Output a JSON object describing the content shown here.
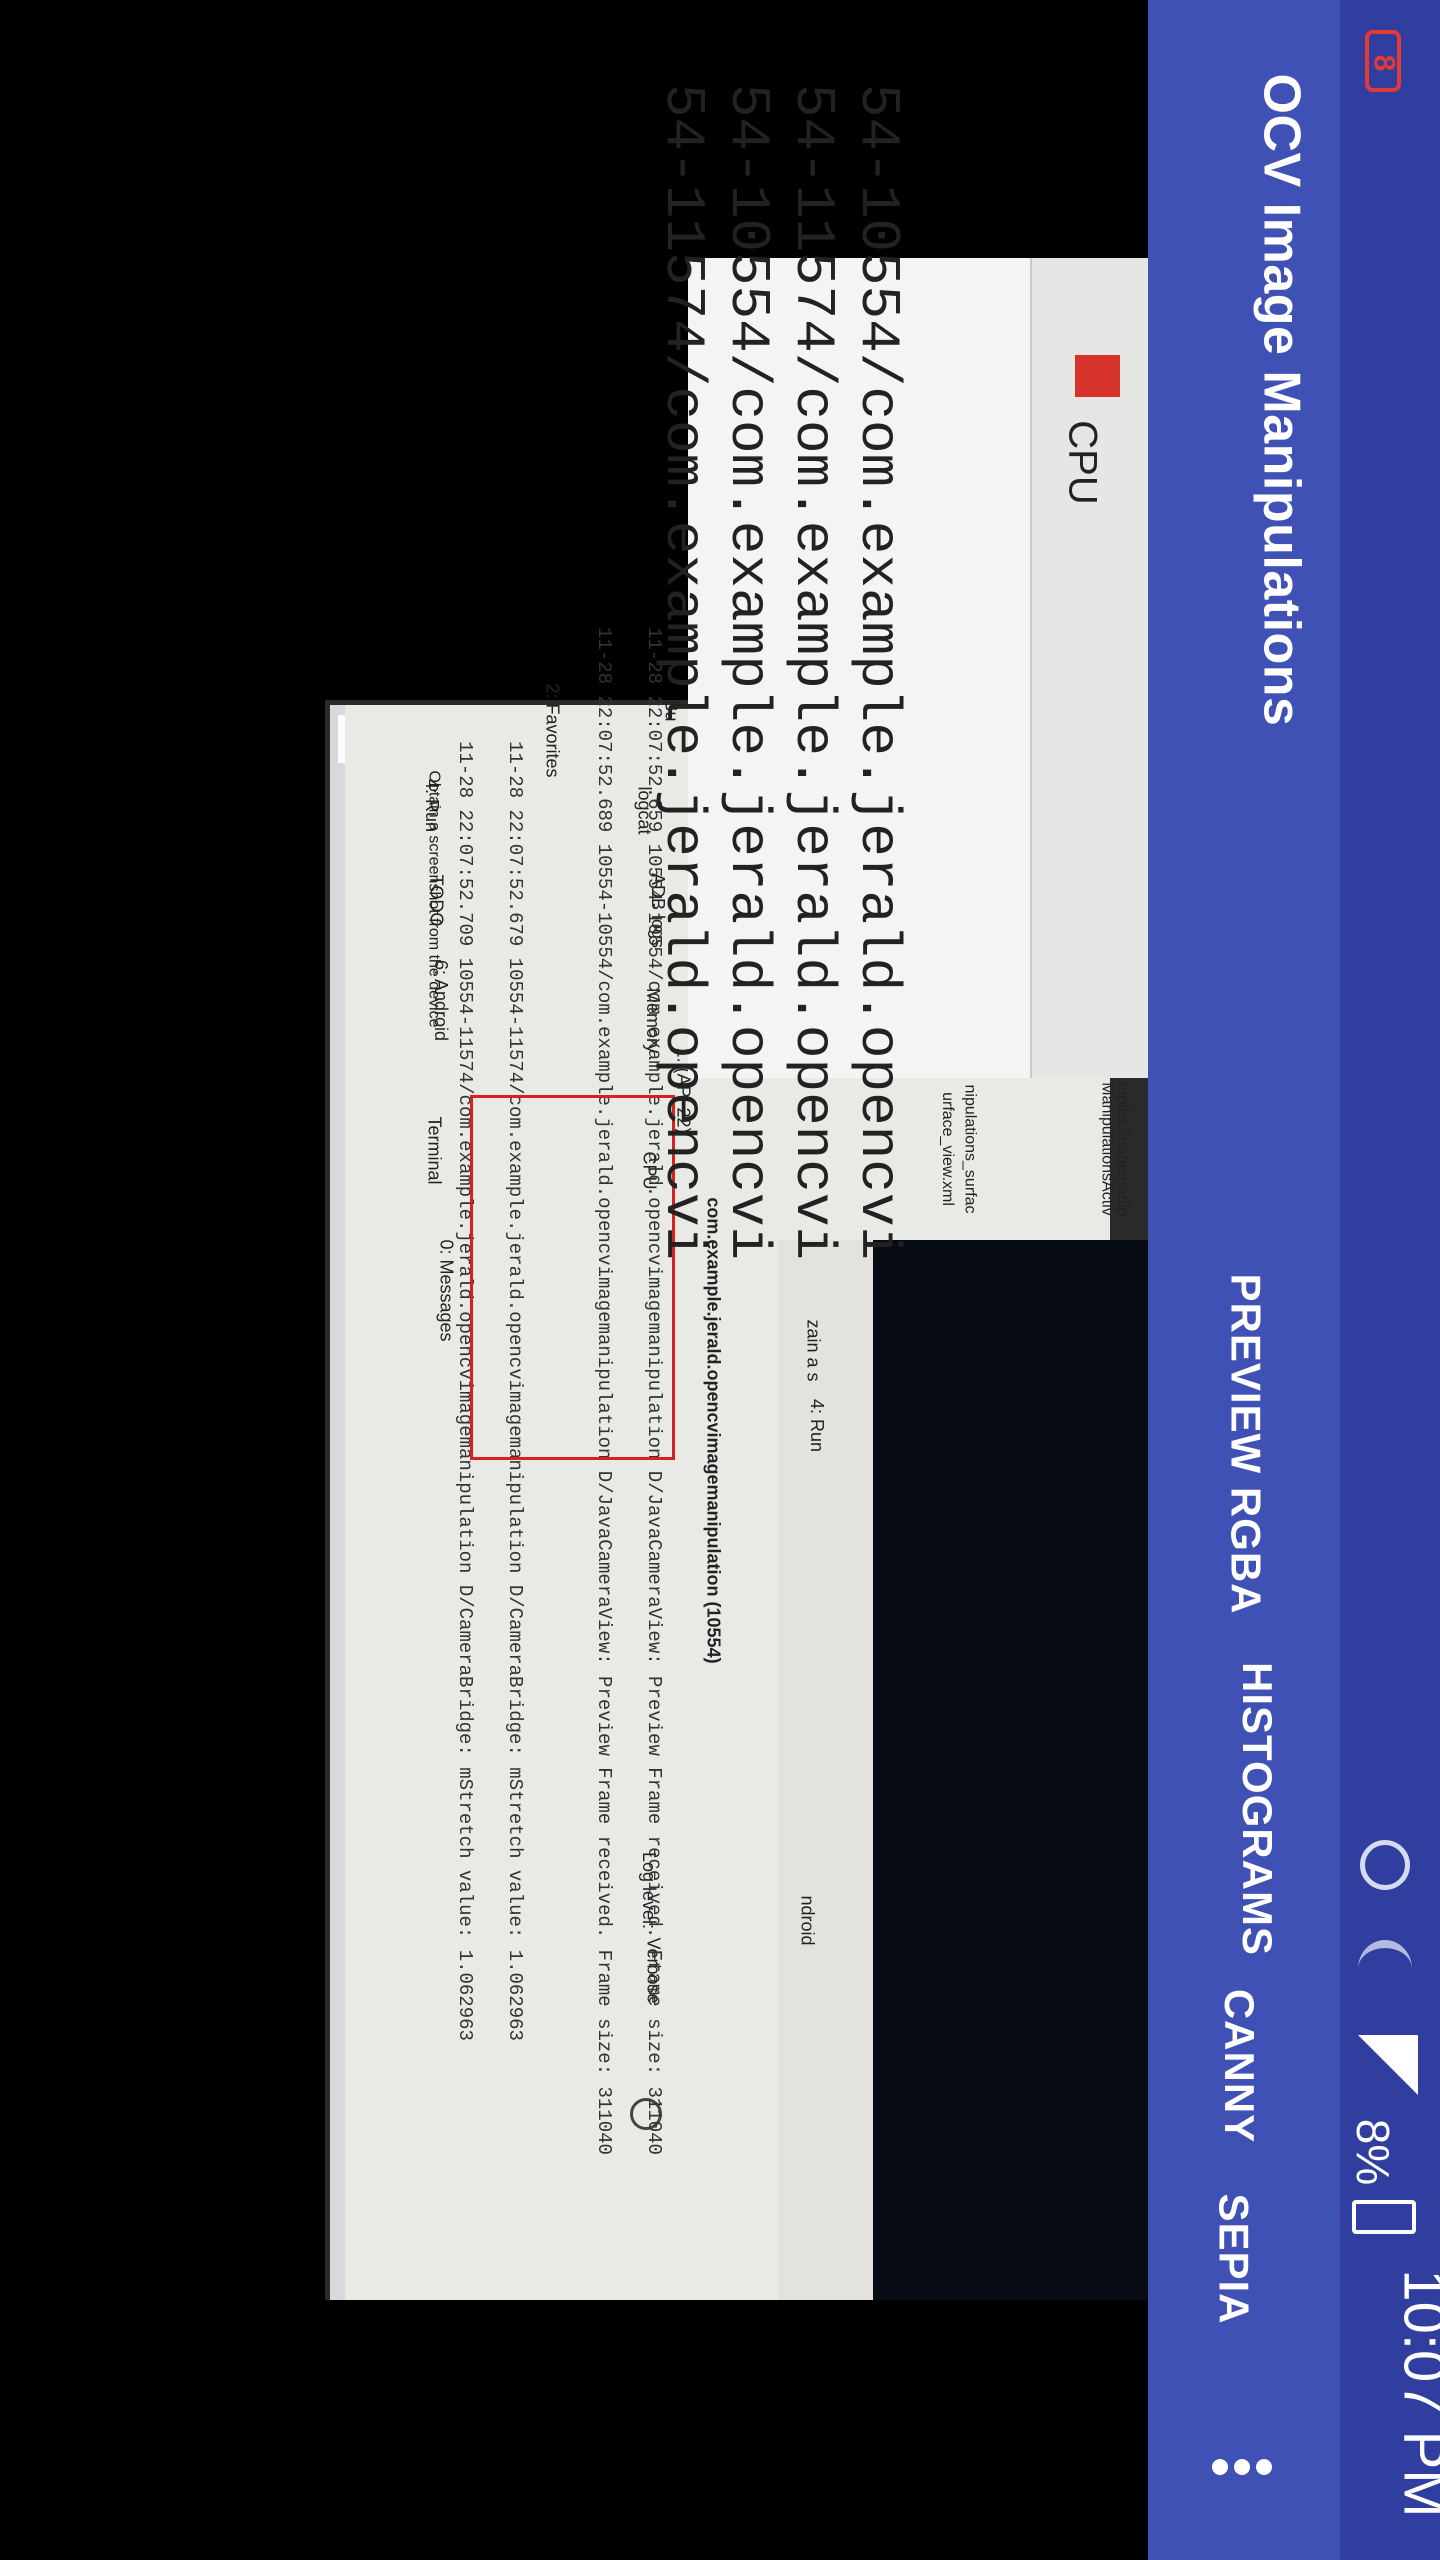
{
  "status_bar": {
    "time": "10:07 PM",
    "battery_percent": "8%",
    "notification_badge": "8"
  },
  "app_bar": {
    "title": "OCV Image Manipulations",
    "menu_items": [
      "PREVIEW RGBA",
      "HISTOGRAMS",
      "CANNY",
      "SEPIA"
    ]
  },
  "preview": {
    "ide": {
      "process_label": "com.example.jerald.opencvimagemanipulation (10554)",
      "device_label": "1. (API 22)",
      "log_level_label": "Log level:",
      "log_level_value": "Verbose",
      "tabs": [
        "logcat",
        "ADB logs",
        "Memory",
        "CPU"
      ],
      "side_tabs": [
        "2: Favorites",
        "Bu"
      ],
      "bottom_tabs": [
        "4: Run",
        "TODO",
        "6: Android",
        "Terminal",
        "0: Messages"
      ],
      "status_message": "Obtain a screenshot from the device",
      "log_lines": [
        "11-28 22:07:52.659  10554-10554/com.example.jerald.opencvimagemanipulation D/JavaCameraView: Preview Frame received. Frame size: 311040",
        "11-28 22:07:52.679  10554-11574/com.example.jerald.opencvimagemanipulation D/CameraBridge: mStretch value: 1.062963",
        "11-28 22:07:52.689  10554-10554/com.example.jerald.opencvimagemanipulation D/JavaCameraView: Preview Frame received. Frame size: 311040",
        "11-28 22:07:52.709  10554-11574/com.example.jerald.opencvimagemanipulation D/CameraBridge: mStretch value: 1.062963"
      ],
      "file_tree": [
        "mples.imagemanip",
        "ManipulationsActiv",
        "nipulations_surfac",
        "urface_view.xml"
      ],
      "right_pane_labels": [
        "zain a s",
        "4: Run",
        "ndroid"
      ]
    },
    "zoom": {
      "toolbar_label": "CPU",
      "lines": [
        "54-10554/com.example.jerald.opencvi",
        "54-11574/com.example.jerald.opencvi",
        "54-10554/com.example.jerald.opencvi",
        "54-11574/com.example.jerald.opencvi"
      ]
    }
  }
}
